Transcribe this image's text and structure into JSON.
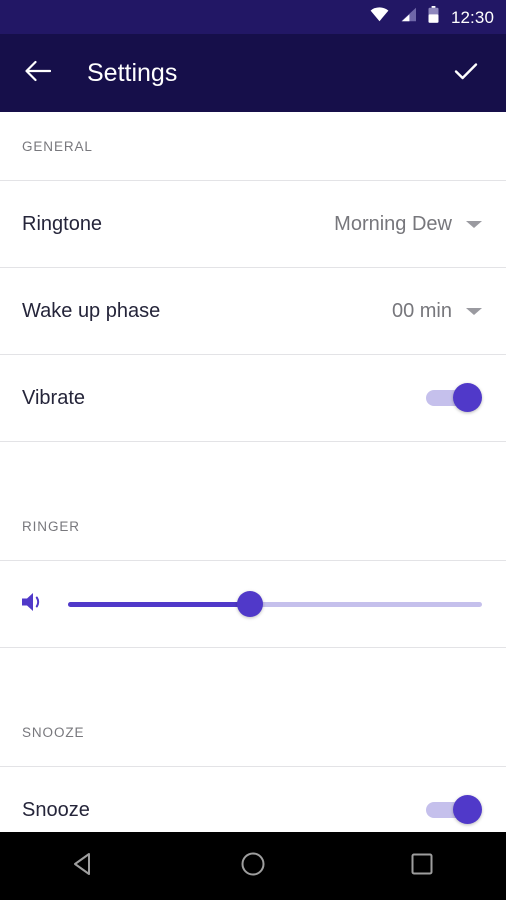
{
  "status_bar": {
    "time": "12:30",
    "icons": [
      "wifi-icon",
      "cellular-signal-icon",
      "battery-icon"
    ],
    "background": "#221765"
  },
  "app_bar": {
    "title": "Settings",
    "back_icon": "back-arrow-icon",
    "confirm_icon": "check-icon",
    "background": "#160f4a"
  },
  "theme": {
    "accent": "#5039c9",
    "accent_light": "#c5c0ec",
    "label_color": "#25253a",
    "value_color": "#77777c",
    "section_color": "#78787d",
    "divider": "#e3e3e6"
  },
  "sections": [
    {
      "title": "GENERAL",
      "rows": [
        {
          "label": "Ringtone",
          "value": "Morning Dew",
          "type": "dropdown"
        },
        {
          "label": "Wake up phase",
          "value": "00 min",
          "type": "dropdown"
        },
        {
          "label": "Vibrate",
          "type": "toggle",
          "checked": true
        }
      ]
    },
    {
      "title": "RINGER",
      "rows": [
        {
          "label": "",
          "type": "slider",
          "icon": "volume-icon",
          "value_percent": 44
        }
      ]
    },
    {
      "title": "SNOOZE",
      "rows": [
        {
          "label": "Snooze",
          "type": "toggle",
          "checked": true
        }
      ]
    }
  ],
  "nav_bar": {
    "back_label": "back-triangle-icon",
    "home_label": "home-circle-icon",
    "recents_label": "recents-square-icon"
  }
}
